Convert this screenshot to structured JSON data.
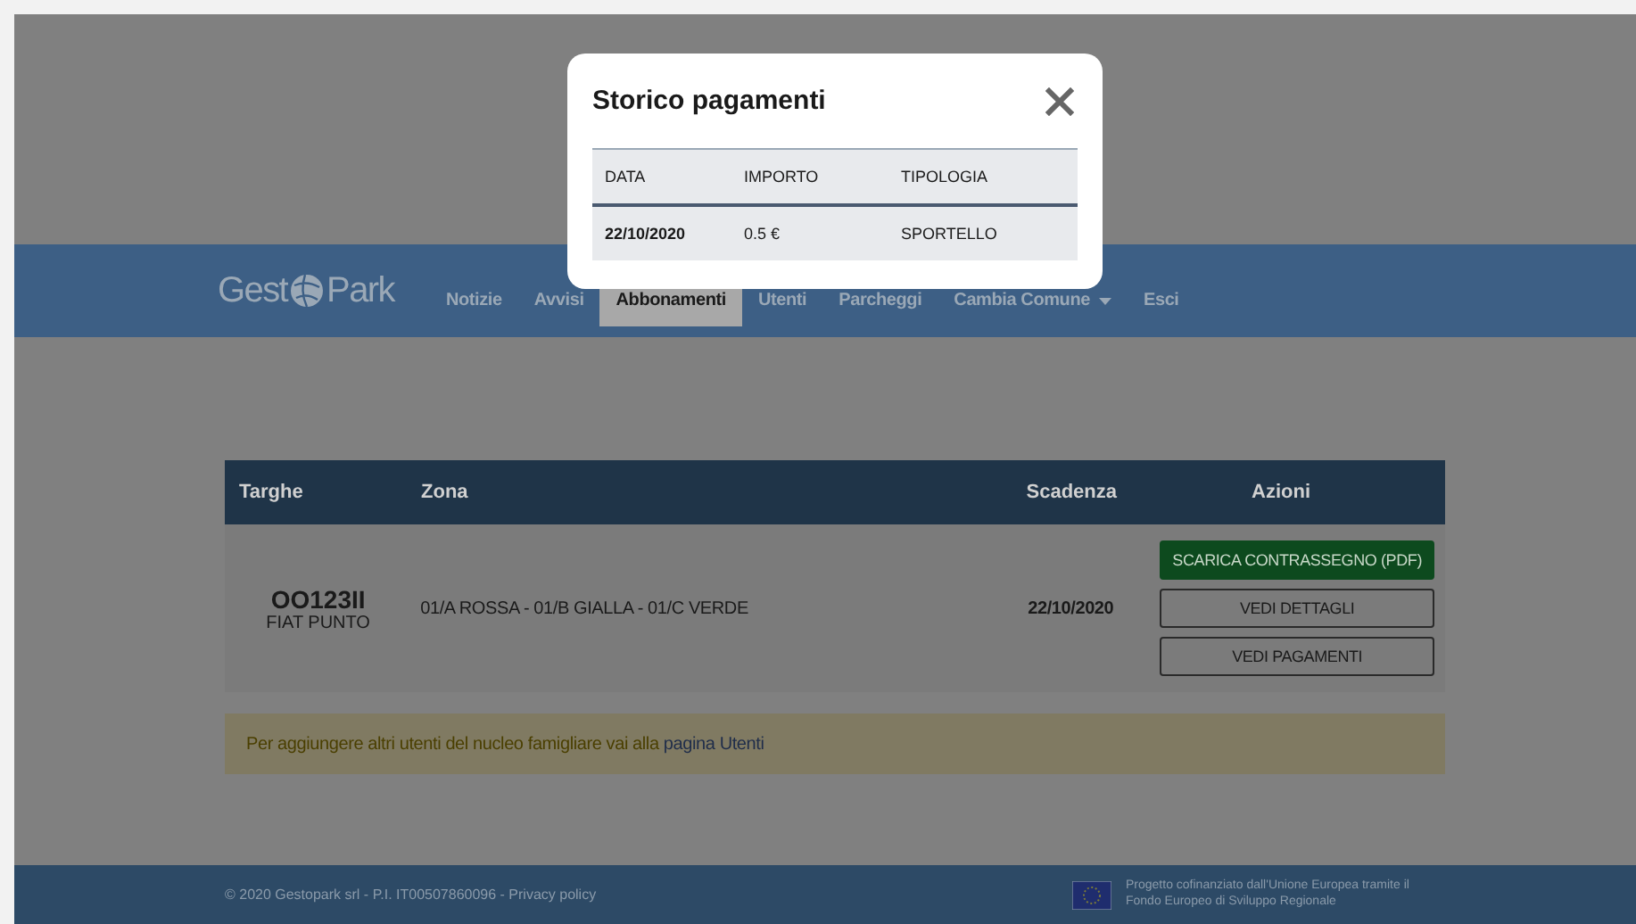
{
  "navbar": {
    "logo": {
      "left": "Gest",
      "right": "Park"
    },
    "items": [
      {
        "label": "Notizie",
        "selected": false,
        "dropdown": false
      },
      {
        "label": "Avvisi",
        "selected": false,
        "dropdown": false
      },
      {
        "label": "Abbonamenti",
        "selected": true,
        "dropdown": false
      },
      {
        "label": "Utenti",
        "selected": false,
        "dropdown": false
      },
      {
        "label": "Parcheggi",
        "selected": false,
        "dropdown": false
      },
      {
        "label": "Cambia Comune",
        "selected": false,
        "dropdown": true
      },
      {
        "label": "Esci",
        "selected": false,
        "dropdown": false
      }
    ]
  },
  "table": {
    "columns": [
      "Targhe",
      "Zona",
      "Scadenza",
      "Azioni"
    ],
    "rows": [
      {
        "plate": "OO123II",
        "model": "FIAT PUNTO",
        "zones": "01/A ROSSA - 01/B GIALLA - 01/C VERDE",
        "expiry": "22/10/2020",
        "actions": [
          {
            "label": "SCARICA CONTRASSEGNO (PDF)",
            "kind": "primary"
          },
          {
            "label": "VEDI DETTAGLI",
            "kind": "outline"
          },
          {
            "label": "VEDI PAGAMENTI",
            "kind": "outline"
          }
        ]
      }
    ]
  },
  "alert": {
    "text": "Per aggiungere altri utenti del nucleo famigliare vai alla ",
    "link": "pagina Utenti"
  },
  "footer": {
    "copyright": "© 2020 Gestopark srl - P.I. IT00507860096 - Privacy policy",
    "eu_note": "Progetto cofinanziato dall'Unione Europea tramite il Fondo Europeo di Sviluppo Regionale"
  },
  "modal": {
    "title": "Storico pagamenti",
    "columns": [
      "DATA",
      "IMPORTO",
      "TIPOLOGIA"
    ],
    "rows": [
      {
        "date": "22/10/2020",
        "amount": "0.5 €",
        "type": "SPORTELLO"
      }
    ]
  }
}
